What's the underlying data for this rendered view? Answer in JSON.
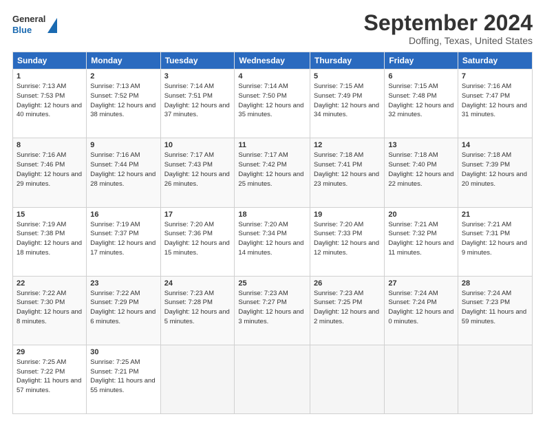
{
  "logo": {
    "line1": "General",
    "line2": "Blue"
  },
  "title": "September 2024",
  "subtitle": "Doffing, Texas, United States",
  "headers": [
    "Sunday",
    "Monday",
    "Tuesday",
    "Wednesday",
    "Thursday",
    "Friday",
    "Saturday"
  ],
  "weeks": [
    [
      {
        "day": "1",
        "sunrise": "7:13 AM",
        "sunset": "7:53 PM",
        "daylight": "12 hours and 40 minutes."
      },
      {
        "day": "2",
        "sunrise": "7:13 AM",
        "sunset": "7:52 PM",
        "daylight": "12 hours and 38 minutes."
      },
      {
        "day": "3",
        "sunrise": "7:14 AM",
        "sunset": "7:51 PM",
        "daylight": "12 hours and 37 minutes."
      },
      {
        "day": "4",
        "sunrise": "7:14 AM",
        "sunset": "7:50 PM",
        "daylight": "12 hours and 35 minutes."
      },
      {
        "day": "5",
        "sunrise": "7:15 AM",
        "sunset": "7:49 PM",
        "daylight": "12 hours and 34 minutes."
      },
      {
        "day": "6",
        "sunrise": "7:15 AM",
        "sunset": "7:48 PM",
        "daylight": "12 hours and 32 minutes."
      },
      {
        "day": "7",
        "sunrise": "7:16 AM",
        "sunset": "7:47 PM",
        "daylight": "12 hours and 31 minutes."
      }
    ],
    [
      {
        "day": "8",
        "sunrise": "7:16 AM",
        "sunset": "7:46 PM",
        "daylight": "12 hours and 29 minutes."
      },
      {
        "day": "9",
        "sunrise": "7:16 AM",
        "sunset": "7:44 PM",
        "daylight": "12 hours and 28 minutes."
      },
      {
        "day": "10",
        "sunrise": "7:17 AM",
        "sunset": "7:43 PM",
        "daylight": "12 hours and 26 minutes."
      },
      {
        "day": "11",
        "sunrise": "7:17 AM",
        "sunset": "7:42 PM",
        "daylight": "12 hours and 25 minutes."
      },
      {
        "day": "12",
        "sunrise": "7:18 AM",
        "sunset": "7:41 PM",
        "daylight": "12 hours and 23 minutes."
      },
      {
        "day": "13",
        "sunrise": "7:18 AM",
        "sunset": "7:40 PM",
        "daylight": "12 hours and 22 minutes."
      },
      {
        "day": "14",
        "sunrise": "7:18 AM",
        "sunset": "7:39 PM",
        "daylight": "12 hours and 20 minutes."
      }
    ],
    [
      {
        "day": "15",
        "sunrise": "7:19 AM",
        "sunset": "7:38 PM",
        "daylight": "12 hours and 18 minutes."
      },
      {
        "day": "16",
        "sunrise": "7:19 AM",
        "sunset": "7:37 PM",
        "daylight": "12 hours and 17 minutes."
      },
      {
        "day": "17",
        "sunrise": "7:20 AM",
        "sunset": "7:36 PM",
        "daylight": "12 hours and 15 minutes."
      },
      {
        "day": "18",
        "sunrise": "7:20 AM",
        "sunset": "7:34 PM",
        "daylight": "12 hours and 14 minutes."
      },
      {
        "day": "19",
        "sunrise": "7:20 AM",
        "sunset": "7:33 PM",
        "daylight": "12 hours and 12 minutes."
      },
      {
        "day": "20",
        "sunrise": "7:21 AM",
        "sunset": "7:32 PM",
        "daylight": "12 hours and 11 minutes."
      },
      {
        "day": "21",
        "sunrise": "7:21 AM",
        "sunset": "7:31 PM",
        "daylight": "12 hours and 9 minutes."
      }
    ],
    [
      {
        "day": "22",
        "sunrise": "7:22 AM",
        "sunset": "7:30 PM",
        "daylight": "12 hours and 8 minutes."
      },
      {
        "day": "23",
        "sunrise": "7:22 AM",
        "sunset": "7:29 PM",
        "daylight": "12 hours and 6 minutes."
      },
      {
        "day": "24",
        "sunrise": "7:23 AM",
        "sunset": "7:28 PM",
        "daylight": "12 hours and 5 minutes."
      },
      {
        "day": "25",
        "sunrise": "7:23 AM",
        "sunset": "7:27 PM",
        "daylight": "12 hours and 3 minutes."
      },
      {
        "day": "26",
        "sunrise": "7:23 AM",
        "sunset": "7:25 PM",
        "daylight": "12 hours and 2 minutes."
      },
      {
        "day": "27",
        "sunrise": "7:24 AM",
        "sunset": "7:24 PM",
        "daylight": "12 hours and 0 minutes."
      },
      {
        "day": "28",
        "sunrise": "7:24 AM",
        "sunset": "7:23 PM",
        "daylight": "11 hours and 59 minutes."
      }
    ],
    [
      {
        "day": "29",
        "sunrise": "7:25 AM",
        "sunset": "7:22 PM",
        "daylight": "11 hours and 57 minutes."
      },
      {
        "day": "30",
        "sunrise": "7:25 AM",
        "sunset": "7:21 PM",
        "daylight": "11 hours and 55 minutes."
      },
      null,
      null,
      null,
      null,
      null
    ]
  ]
}
